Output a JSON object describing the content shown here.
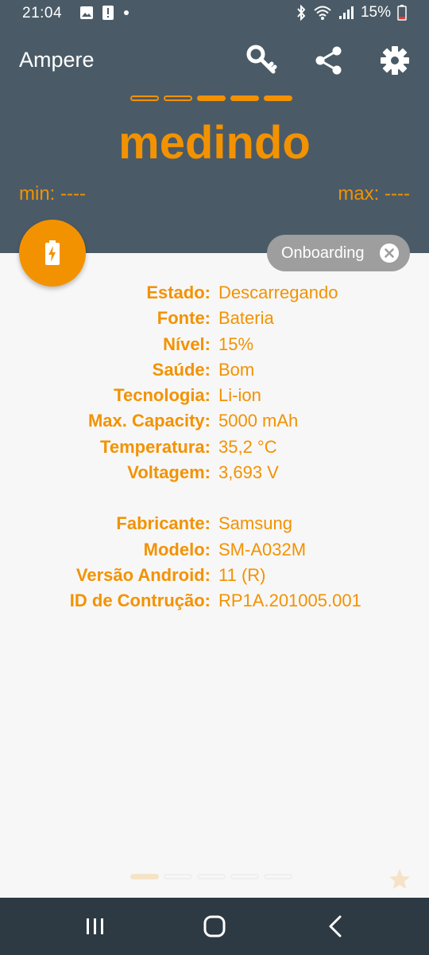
{
  "status_bar": {
    "time": "21:04",
    "battery_text": "15%"
  },
  "header": {
    "title": "Ampere",
    "icons": [
      "key-icon",
      "share-icon",
      "gear-icon"
    ],
    "measuring_text": "medindo",
    "min_label": "min: ----",
    "max_label": "max: ----",
    "indicator_dots": [
      "empty",
      "empty",
      "full",
      "full",
      "full"
    ]
  },
  "chip": {
    "label": "Onboarding"
  },
  "info_group_1": [
    {
      "label": "Estado:",
      "value": "Descarregando"
    },
    {
      "label": "Fonte:",
      "value": "Bateria"
    },
    {
      "label": "Nível:",
      "value": "15%"
    },
    {
      "label": "Saúde:",
      "value": "Bom"
    },
    {
      "label": "Tecnologia:",
      "value": "Li-ion"
    },
    {
      "label": "Max. Capacity:",
      "value": "5000 mAh"
    },
    {
      "label": "Temperatura:",
      "value": "35,2 °C"
    },
    {
      "label": "Voltagem:",
      "value": "3,693 V"
    }
  ],
  "info_group_2": [
    {
      "label": "Fabricante:",
      "value": "Samsung"
    },
    {
      "label": "Modelo:",
      "value": "SM-A032M"
    },
    {
      "label": "Versão Android:",
      "value": "11 (R)"
    },
    {
      "label": "ID de Contrução:",
      "value": "RP1A.201005.001"
    }
  ],
  "colors": {
    "accent": "#f39200",
    "header_bg": "#4a5b67",
    "nav_bg": "#2d3a43",
    "chip_bg": "#9e9e9e"
  }
}
